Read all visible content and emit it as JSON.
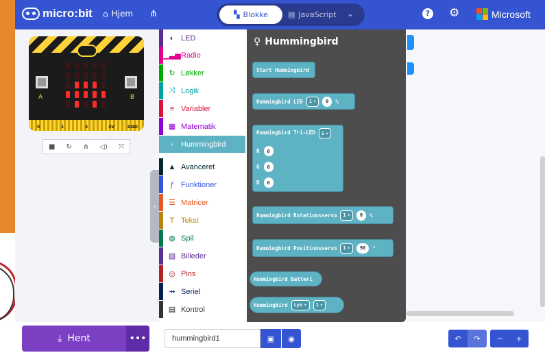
{
  "header": {
    "logo_text": "micro:bit",
    "home_label": "Hjem",
    "tab_blocks": "Blokke",
    "tab_javascript": "JavaScript",
    "brand": "Microsoft",
    "colors": {
      "header_bg": "#3454d1",
      "accent_hummingbird": "#5db2c4",
      "download_bg": "#7b3fc4"
    }
  },
  "simulator": {
    "pin_labels": [
      "0",
      "1",
      "2",
      "3V",
      "GND"
    ],
    "button_a": "A",
    "button_b": "B"
  },
  "toolbox": {
    "categories": [
      {
        "label": "LED",
        "icon": "toggle-icon",
        "color": "#5c2d91"
      },
      {
        "label": "Radio",
        "icon": "signal-icon",
        "color": "#e3008c"
      },
      {
        "label": "Løkker",
        "icon": "loop-icon",
        "color": "#00aa00"
      },
      {
        "label": "Logik",
        "icon": "shuffle-icon",
        "color": "#00a4a6"
      },
      {
        "label": "Variabler",
        "icon": "list-icon",
        "color": "#dc143c"
      },
      {
        "label": "Matematik",
        "icon": "calculator-icon",
        "color": "#9400d3"
      },
      {
        "label": "Hummingbird",
        "icon": "lightbulb-icon",
        "color": "#5db2c4"
      },
      {
        "label": "Avanceret",
        "icon": "chevron-up-icon",
        "color": "#00272b"
      },
      {
        "label": "Funktioner",
        "icon": "function-icon",
        "color": "#3455db"
      },
      {
        "label": "Matricer",
        "icon": "list-ordered-icon",
        "color": "#e65722"
      },
      {
        "label": "Tekst",
        "icon": "text-icon",
        "color": "#b8860b"
      },
      {
        "label": "Spil",
        "icon": "gamepad-icon",
        "color": "#007a4b"
      },
      {
        "label": "Billeder",
        "icon": "image-icon",
        "color": "#5c2d91"
      },
      {
        "label": "Pins",
        "icon": "pin-icon",
        "color": "#b22222"
      },
      {
        "label": "Seriel",
        "icon": "usb-icon",
        "color": "#002050"
      },
      {
        "label": "Kontrol",
        "icon": "control-icon",
        "color": "#333333"
      }
    ]
  },
  "flyout": {
    "title": "Hummingbird",
    "start": "Start Hummingbird",
    "led": {
      "label": "Hummingbird LED",
      "port": "1",
      "value": "0",
      "unit": "%"
    },
    "trileds": {
      "label": "Hummingbird Tri-LED",
      "port": "1",
      "r_label": "R",
      "r": "0",
      "g_label": "G",
      "g": "0",
      "b_label": "B",
      "b": "0"
    },
    "rot_servo": {
      "label": "Hummingbird Rotationsservo",
      "port": "1",
      "value": "0",
      "unit": "%"
    },
    "pos_servo": {
      "label": "Hummingbird Positionsservo",
      "port": "1",
      "value": "90",
      "unit": "°"
    },
    "battery": "Hummingbird Batteri",
    "light": {
      "label": "Hummingbird",
      "sensor": "Lys",
      "port": "1"
    }
  },
  "footer": {
    "download_label": "Hent",
    "more_label": "•••",
    "project_name": "hummingbird1"
  }
}
